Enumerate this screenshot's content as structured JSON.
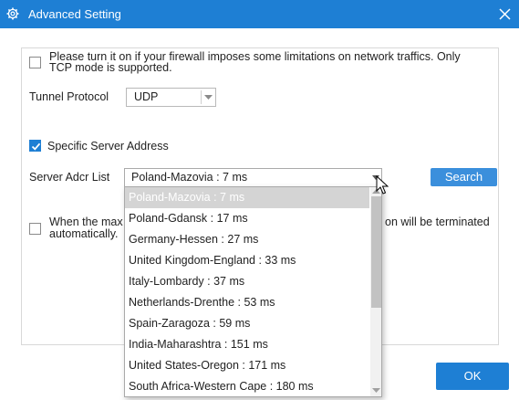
{
  "window": {
    "title": "Advanced Setting"
  },
  "firewall": {
    "checked": false,
    "text_line1": "Please turn it on if your firewall imposes some limitations on network traffics. Only",
    "text_line2": "TCP mode is supported."
  },
  "tunnel": {
    "label": "Tunnel Protocol",
    "value": "UDP"
  },
  "specific_server": {
    "checked": true,
    "label": "Specific Server Address"
  },
  "server_list": {
    "label": "Server Adcr List",
    "value": "Poland-Mazovia : 7 ms",
    "search_label": "Search",
    "options": [
      "Poland-Mazovia : 7 ms",
      "Poland-Gdansk : 17 ms",
      "Germany-Hessen : 27 ms",
      "United Kingdom-England : 33 ms",
      "Italy-Lombardy : 37 ms",
      "Netherlands-Drenthe : 53 ms",
      "Spain-Zaragoza : 59 ms",
      "India-Maharashtra : 151 ms",
      "United States-Oregon : 171 ms",
      "South Africa-Western Cape : 180 ms"
    ],
    "selected_index": 0
  },
  "terminate": {
    "checked": false,
    "text_left_line1": "When the max",
    "text_right_line1": "on will be terminated",
    "text_line2": "automatically."
  },
  "ok_label": "OK",
  "colors": {
    "accent": "#1e7fd4",
    "search_button": "#3b8fdc",
    "selected_row": "#d4d4d4"
  }
}
